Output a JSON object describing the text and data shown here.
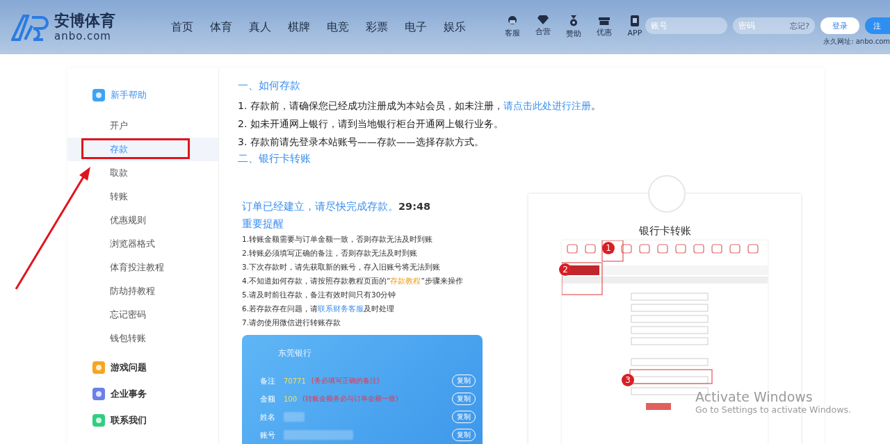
{
  "header": {
    "logo": {
      "name": "安博体育",
      "domain": "anbo.com"
    },
    "nav": [
      {
        "label": "首页"
      },
      {
        "label": "体育"
      },
      {
        "label": "真人"
      },
      {
        "label": "棋牌"
      },
      {
        "label": "电竞"
      },
      {
        "label": "彩票"
      },
      {
        "label": "电子"
      },
      {
        "label": "娱乐"
      }
    ],
    "quick_links": [
      {
        "label": "客服",
        "kind": "service"
      },
      {
        "label": "合营",
        "kind": "diamond"
      },
      {
        "label": "赞助",
        "kind": "medal"
      },
      {
        "label": "优惠",
        "kind": "gift"
      },
      {
        "label": "APP",
        "kind": "phone"
      }
    ],
    "account": {
      "placeholder": "账号"
    },
    "password": {
      "placeholder": "密码",
      "forgot": "忘记?"
    },
    "login_button": "登录",
    "register_button": "注",
    "permanent_url": "永久网址: anbo.com"
  },
  "sidebar": {
    "groups": [
      {
        "title": "新手帮助",
        "kind": "help",
        "expanded": true,
        "items": [
          {
            "label": "开户",
            "selected": false
          },
          {
            "label": "存款",
            "selected": true
          },
          {
            "label": "取款",
            "selected": false
          },
          {
            "label": "转账",
            "selected": false
          },
          {
            "label": "优惠规则",
            "selected": false
          },
          {
            "label": "浏览器格式",
            "selected": false
          },
          {
            "label": "体育投注教程",
            "selected": false
          },
          {
            "label": "防劫持教程",
            "selected": false
          },
          {
            "label": "忘记密码",
            "selected": false
          },
          {
            "label": "钱包转账",
            "selected": false
          }
        ]
      },
      {
        "title": "游戏问题",
        "kind": "game",
        "expanded": false
      },
      {
        "title": "企业事务",
        "kind": "doc",
        "expanded": false
      },
      {
        "title": "联系我们",
        "kind": "contact",
        "expanded": false
      }
    ]
  },
  "content": {
    "section_1": "一、如何存款",
    "steps": [
      [
        {
          "kind": "plain",
          "text": "1. 存款前，请确保您已经成功注册成为本站会员，如未注册，"
        },
        {
          "kind": "link",
          "text": "请点击此处进行注册"
        },
        {
          "kind": "plain",
          "text": "。"
        }
      ],
      [
        {
          "kind": "plain",
          "text": "2. 如未开通网上银行，请到当地银行柜台开通网上银行业务。"
        }
      ],
      [
        {
          "kind": "plain",
          "text": "3. 存款前请先登录本站账号——存款——选择存款方式。"
        }
      ]
    ],
    "section_2": "二、银行卡转账",
    "order": {
      "message": "订单已经建立，请尽快完成存款。",
      "timer": "29:48",
      "reminder_title": "重要提醒",
      "reminders": [
        [
          {
            "kind": "plain",
            "text": "1.转账金额需要与订单金额一致，否则存款无法及时到账"
          }
        ],
        [
          {
            "kind": "plain",
            "text": "2.转账必须填写正确的备注，否则存款无法及时到账"
          }
        ],
        [
          {
            "kind": "plain",
            "text": "3.下次存款时，请先获取新的账号，存入旧账号将无法到账"
          }
        ],
        [
          {
            "kind": "plain",
            "text": "4.不知道如何存款，请按照存款教程页面的“"
          },
          {
            "kind": "highlight",
            "text": "存款教程"
          },
          {
            "kind": "plain",
            "text": "”步骤来操作"
          }
        ],
        [
          {
            "kind": "plain",
            "text": "5.请及时前往存款，备注有效时间只有30分钟"
          }
        ],
        [
          {
            "kind": "plain",
            "text": "6.若存款存在问题，请"
          },
          {
            "kind": "link",
            "text": "联系财务客服"
          },
          {
            "kind": "plain",
            "text": "及时处理"
          }
        ],
        [
          {
            "kind": "plain",
            "text": "7.请勿使用微信进行转账存款"
          }
        ]
      ],
      "bank_card": {
        "bank": "东莞银行",
        "rows": [
          {
            "label": "备注",
            "kind": "value",
            "value": "70771",
            "note": "(务必填写正确的备注)",
            "button": "复制"
          },
          {
            "label": "金额",
            "kind": "value",
            "value": "100",
            "note": "(转账金额务必与订单金额一致)",
            "button": "复制"
          },
          {
            "label": "姓名",
            "kind": "hidden",
            "button": "复制"
          },
          {
            "label": "账号",
            "kind": "hidden",
            "button": "复制"
          }
        ]
      }
    },
    "example": {
      "title": "银行卡转账",
      "markers": [
        "1",
        "2",
        "3"
      ]
    }
  },
  "os_notice": {
    "title": "Activate Windows",
    "text": "Go to Settings to activate Windows."
  }
}
